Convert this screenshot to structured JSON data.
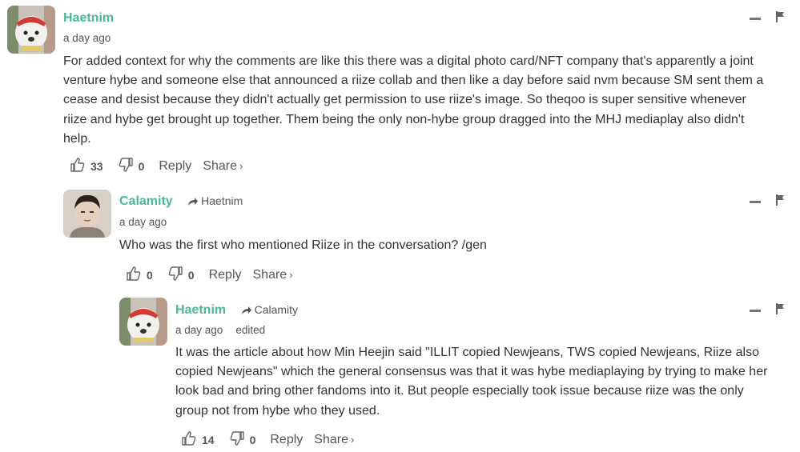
{
  "comments": [
    {
      "author": "Haetnim",
      "reply_to": "",
      "time": "a day ago",
      "edited": "",
      "lines": [
        "For added context for why the comments are like this there was a digital photo card/NFT company that's apparently a joint",
        "venture hybe and someone else that announced a riize collab and then like a day before said nvm because SM sent them a",
        "cease and desist because they didn't actually get permission to use riize's image. So theqoo is super sensitive whenever",
        "riize and hybe get brought up together. Them being the only non-hybe group dragged into the MHJ mediaplay also didn't",
        "help."
      ],
      "upvotes": "33",
      "downvotes": "0",
      "reply_label": "Reply",
      "share_label": "Share",
      "share_chevron": "›"
    },
    {
      "author": "Calamity",
      "reply_to": "Haetnim",
      "time": "a day ago",
      "edited": "",
      "lines": [
        "Who was the first who mentioned Riize in the conversation? /gen"
      ],
      "upvotes": "0",
      "downvotes": "0",
      "reply_label": "Reply",
      "share_label": "Share",
      "share_chevron": "›"
    },
    {
      "author": "Haetnim",
      "reply_to": "Calamity",
      "time": "a day ago",
      "edited": "edited",
      "lines": [
        "It was the article about how Min Heejin said \"ILLIT copied Newjeans, TWS copied Newjeans, Riize also",
        "copied Newjeans\" which the general consensus was that it was hybe mediaplaying by trying to make her",
        "look bad and bring other fandoms into it. But people especially took issue because riize was the only",
        "group not from hybe who they used."
      ],
      "upvotes": "14",
      "downvotes": "0",
      "reply_label": "Reply",
      "share_label": "Share",
      "share_chevron": "›"
    }
  ],
  "icons": {
    "upvote": "thumbs-up-icon",
    "downvote": "thumbs-down-icon",
    "collapse": "minus-icon",
    "report": "flag-icon",
    "reply_arrow": "reply-arrow-icon"
  },
  "colors": {
    "author": "#4bb89a",
    "text": "#333333",
    "muted": "#555555"
  }
}
